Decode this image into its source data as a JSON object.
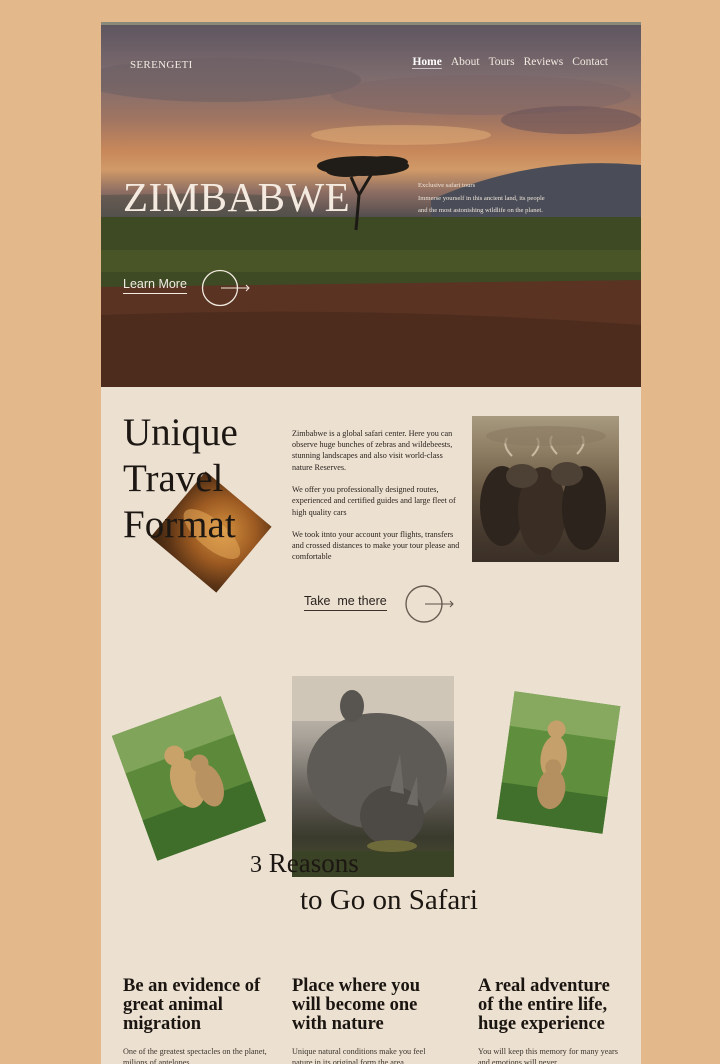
{
  "hero": {
    "logo": "SERENGETI",
    "nav": [
      "Home",
      "About",
      "Tours",
      "Reviews",
      "Contact"
    ],
    "title": "ZIMBABWE",
    "description": [
      "Exclusive safari tours",
      "Immerse yourself in this ancient land, its people",
      "and the most astonishing wildlife on the planet."
    ],
    "cta": "Learn More"
  },
  "unique": {
    "title_lines": [
      "Unique",
      "Travel",
      "Format"
    ],
    "paragraphs": [
      "Zimbabwe is a global safari center. Here you can observe huge bunches of zebras and wildebeests, stunning landscapes and also visit world-class nature Reserves.",
      "We offer you professionally designed routes, experienced and certified guides and large fleet of high quality cars",
      "We took itnto your account your flights, transfers and crossed distances to make your tour please and comfortable"
    ],
    "cta": "Take  me there"
  },
  "reasons": {
    "number": "3",
    "line1": "Reasons",
    "line2": "to Go on Safari"
  },
  "columns": [
    {
      "title": "Be an evidence of great animal migration",
      "text": "One of the greatest spectacles on the planet, milions of antelopes"
    },
    {
      "title": "Place where you will become one with nature",
      "text": "Unique natural conditions make you feel nature in its original form the area"
    },
    {
      "title": "A real adventure of the entire life, huge experience",
      "text": "You will keep this memory for many years and emotions will never"
    }
  ],
  "colors": {
    "page_bg": "#e3b98b",
    "content_bg": "#ece0d1",
    "text_dark": "#1c1712"
  },
  "icons": [
    "circle-arrow-icon"
  ]
}
